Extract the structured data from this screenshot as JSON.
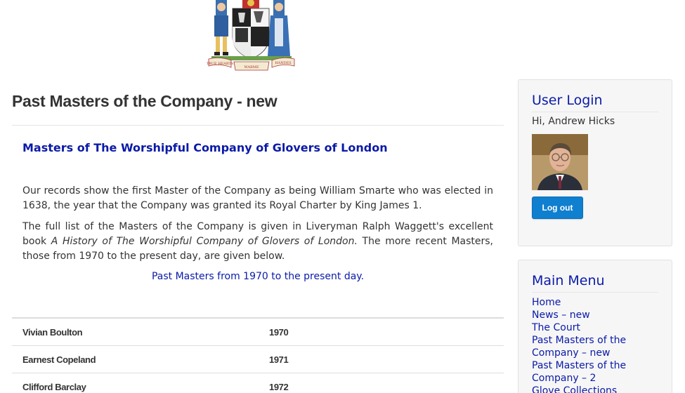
{
  "crest": {
    "motto_left": "TRUE HEARTS",
    "motto_center": "WARME",
    "motto_right": "HANDES"
  },
  "main": {
    "page_title": "Past Masters of the Company - new",
    "subtitle": "Masters of The Worshipful Company of Glovers of London",
    "paragraph1": "Our records show the first Master of the Company as being William Smarte who was elected in 1638, the year that the Company was granted its Royal Charter by King James 1.",
    "paragraph2_start": "The full list of the Masters of the Company is given in Liveryman Ralph Waggett's excellent book ",
    "paragraph2_book": "A History of The Worshipful Company of Glovers of London.",
    "paragraph2_end": " The more recent Masters, those from 1970 to the present day, are given below.",
    "link_text": "Past Masters from 1970 to the present day.",
    "masters": [
      {
        "name": "Vivian Boulton",
        "year": "1970"
      },
      {
        "name": "Earnest Copeland",
        "year": "1971"
      },
      {
        "name": "Clifford Barclay",
        "year": "1972"
      }
    ]
  },
  "sidebar": {
    "login": {
      "title": "User Login",
      "greeting": "Hi, Andrew Hicks",
      "logout_label": "Log out"
    },
    "menu": {
      "title": "Main Menu",
      "items": [
        "Home",
        "News – new",
        "The Court",
        "Past Masters of the Company – new",
        "Past Masters of the Company – 2",
        "Glove Collections"
      ]
    }
  },
  "colors": {
    "link": "#0a1aa8",
    "button": "#0f7fd0",
    "sidebar_bg": "#f6f6f6"
  }
}
